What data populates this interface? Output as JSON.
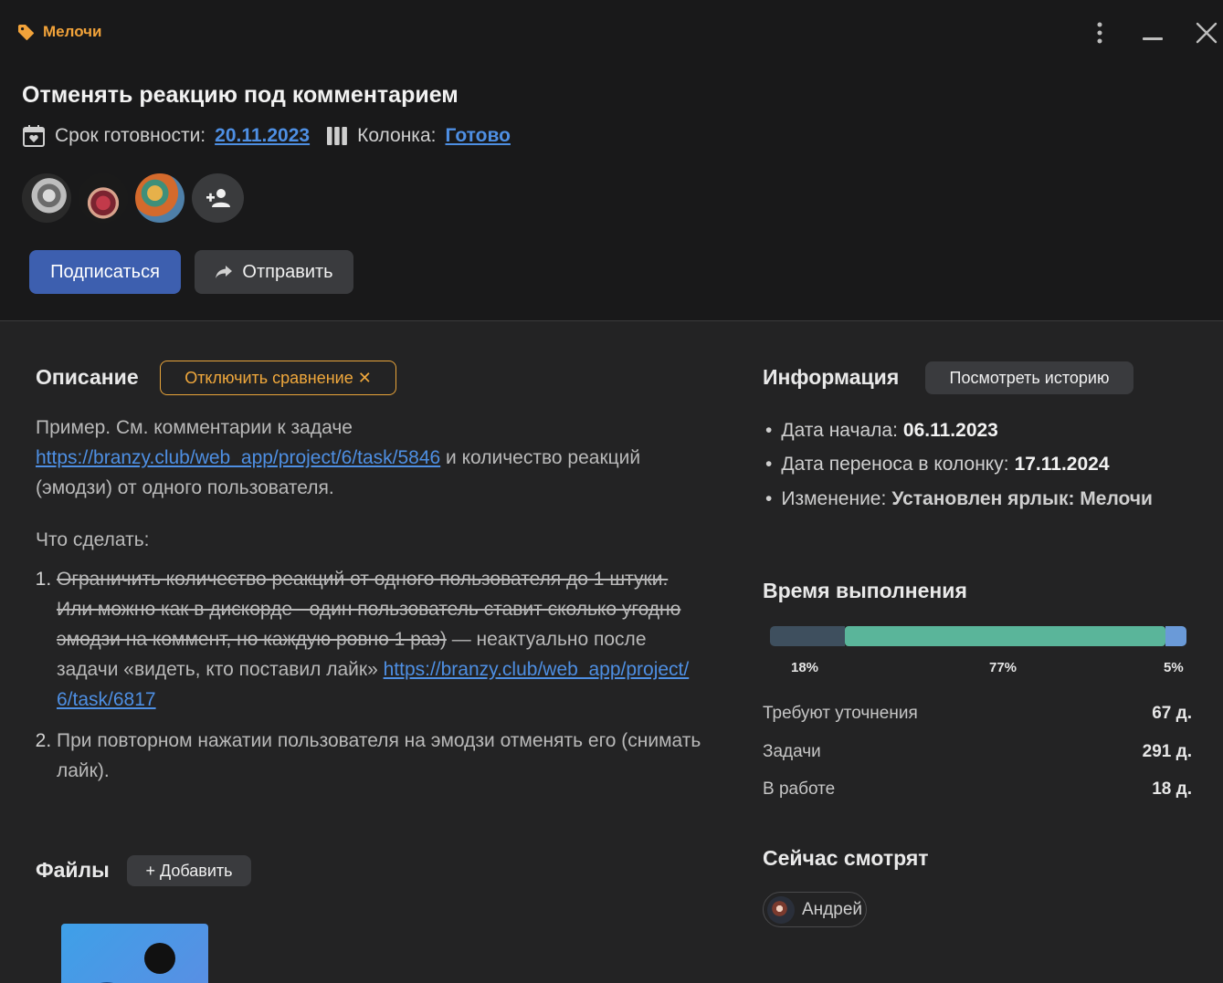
{
  "header": {
    "label": "Мелочи",
    "title": "Отменять реакцию под комментарием",
    "deadline_label": "Срок готовности:",
    "deadline_value": "20.11.2023",
    "column_label": "Колонка:",
    "column_value": "Готово",
    "subscribe_label": "Подписаться",
    "send_label": "Отправить"
  },
  "description": {
    "title": "Описание",
    "compare_button": "Отключить сравнение ✕",
    "intro_before": "Пример. См. комментарии к задаче ",
    "intro_link": "https://branzy.club/web_app/project/6/task/5846",
    "intro_after": " и количество реакций (эмодзи) от одного пользователя.",
    "todo_heading": "Что сделать:",
    "item1_strike": "Ограничить количество реакций от одного пользователя до 1 штуки. Или можно как в дискорде - один пользователь ставит сколько угодно эмодзи на коммент, но каждую ровно 1 раз)",
    "item1_text": " — неактуально после задачи «видеть, кто поставил лайк» ",
    "item1_link": "https://branzy.club/web_app/project/6/task/6817",
    "item2_text": "При повторном нажатии пользователя на эмодзи отменять его (снимать лайк)."
  },
  "files": {
    "title": "Файлы",
    "add_button": "+ Добавить"
  },
  "info": {
    "title": "Информация",
    "history_button": "Посмотреть историю",
    "items": [
      {
        "label": "Дата начала:",
        "value": "06.11.2023"
      },
      {
        "label": "Дата переноса в колонку:",
        "value": "17.11.2024"
      },
      {
        "label": "Изменение:",
        "value": "Установлен ярлык: Мелочи"
      }
    ]
  },
  "timing": {
    "title": "Время выполнения",
    "segments": [
      {
        "percent_label": "18%",
        "fraction": 0.18,
        "color": "#3e4f5e"
      },
      {
        "percent_label": "77%",
        "fraction": 0.77,
        "color": "#5ab59a"
      },
      {
        "percent_label": "5%",
        "fraction": 0.05,
        "color": "#6a9ad8"
      }
    ],
    "rows": [
      {
        "label": "Требуют уточнения",
        "value": "67 д."
      },
      {
        "label": "Задачи",
        "value": "291 д."
      },
      {
        "label": "В работе",
        "value": "18 д."
      }
    ]
  },
  "viewers": {
    "title": "Сейчас смотрят",
    "items": [
      {
        "name": "Андрей"
      }
    ]
  },
  "colors": {
    "label_accent": "#f2a33a",
    "link": "#4e8fe3",
    "primary_button": "#3d5faf"
  }
}
